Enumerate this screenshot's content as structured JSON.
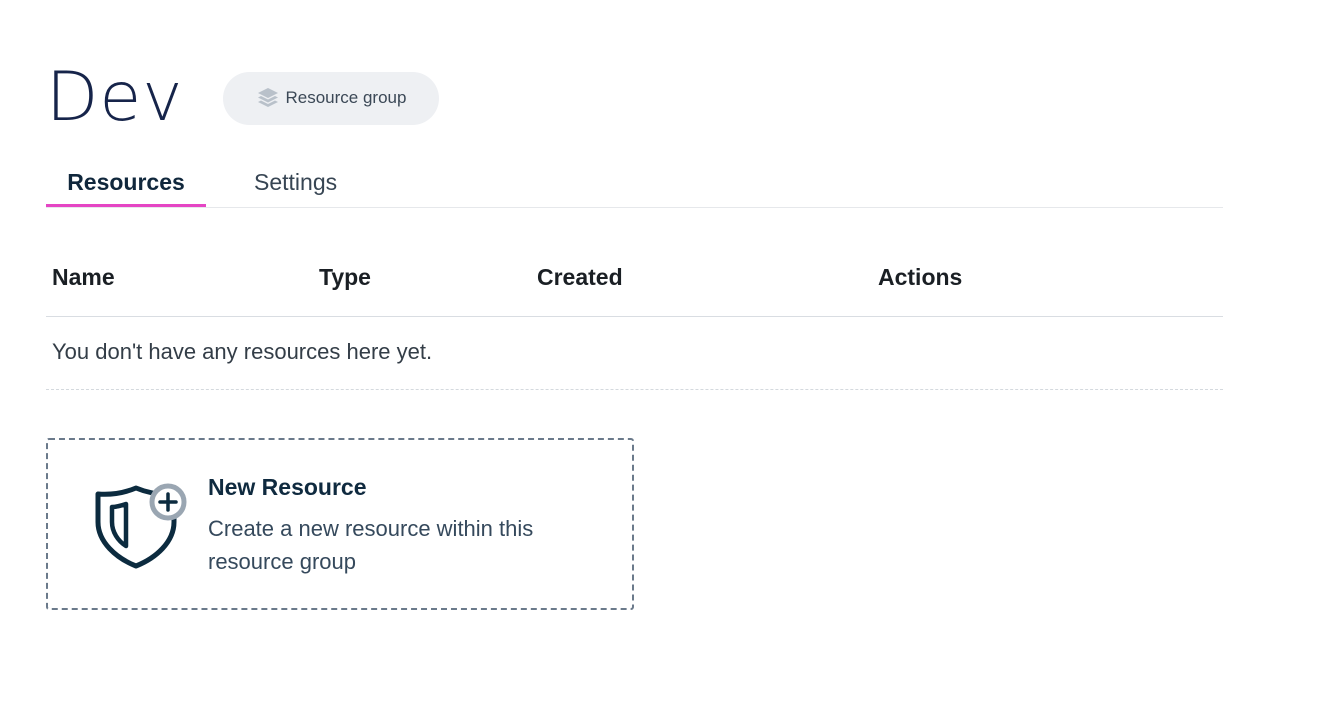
{
  "header": {
    "title": "Dev",
    "badge_label": "Resource group",
    "badge_icon": "layers-icon"
  },
  "tabs": [
    {
      "label": "Resources",
      "active": true
    },
    {
      "label": "Settings",
      "active": false
    }
  ],
  "table": {
    "columns": [
      "Name",
      "Type",
      "Created",
      "Actions"
    ],
    "empty_message": "You don't have any resources here yet."
  },
  "new_resource_card": {
    "title": "New Resource",
    "description": "Create a new resource within this resource group",
    "icon": "shield-plus-icon"
  },
  "colors": {
    "accent_tab": "#e545c4",
    "title": "#16244a",
    "badge_bg": "#eef0f3",
    "card_border": "#6b7a8b"
  }
}
